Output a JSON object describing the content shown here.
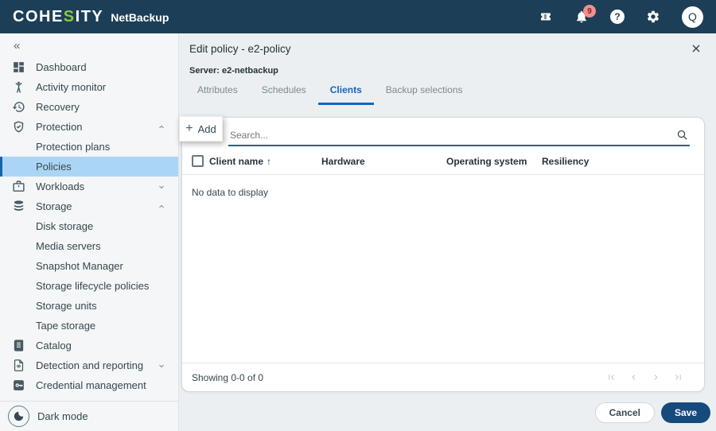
{
  "header": {
    "brand_pre": "COHE",
    "brand_accent": "S",
    "brand_post": "ITY",
    "product": "NetBackup",
    "notification_count": "9",
    "help_symbol": "?",
    "avatar_initial": "Q"
  },
  "sidebar": {
    "collapse_icon": "«",
    "items": [
      {
        "label": "Dashboard"
      },
      {
        "label": "Activity monitor"
      },
      {
        "label": "Recovery"
      },
      {
        "label": "Protection",
        "expanded": true
      },
      {
        "label": "Protection plans"
      },
      {
        "label": "Policies",
        "selected": true
      },
      {
        "label": "Workloads",
        "expanded": false
      },
      {
        "label": "Storage",
        "expanded": true
      },
      {
        "label": "Disk storage"
      },
      {
        "label": "Media servers"
      },
      {
        "label": "Snapshot Manager"
      },
      {
        "label": "Storage lifecycle policies"
      },
      {
        "label": "Storage units"
      },
      {
        "label": "Tape storage"
      },
      {
        "label": "Catalog"
      },
      {
        "label": "Detection and reporting",
        "expanded": false
      },
      {
        "label": "Credential management"
      }
    ],
    "dark_mode_label": "Dark mode"
  },
  "panel": {
    "title": "Edit policy - e2-policy",
    "server_label": "Server: e2-netbackup",
    "tabs": [
      {
        "label": "Attributes",
        "active": false
      },
      {
        "label": "Schedules",
        "active": false
      },
      {
        "label": "Clients",
        "active": true
      },
      {
        "label": "Backup selections",
        "active": false
      }
    ],
    "add_button": {
      "plus": "+",
      "label": "Add"
    },
    "search_placeholder": "Search...",
    "table": {
      "columns": [
        "Client name",
        "Hardware",
        "Operating system",
        "Resiliency"
      ],
      "sort_column": "Client name",
      "sort_arrow": "↑",
      "empty_message": "No data to display"
    },
    "footer": {
      "showing_text": "Showing 0-0 of 0"
    },
    "actions": {
      "cancel": "Cancel",
      "save": "Save"
    }
  },
  "colors": {
    "header_bg": "#1d3e57",
    "brand_green": "#8dc63f",
    "primary_blue": "#1565c0",
    "save_button_bg": "#164a7d",
    "selected_item_bg": "#abd5f5",
    "notification_badge_bg": "#f0908f",
    "search_underline": "#2e5c8e"
  }
}
